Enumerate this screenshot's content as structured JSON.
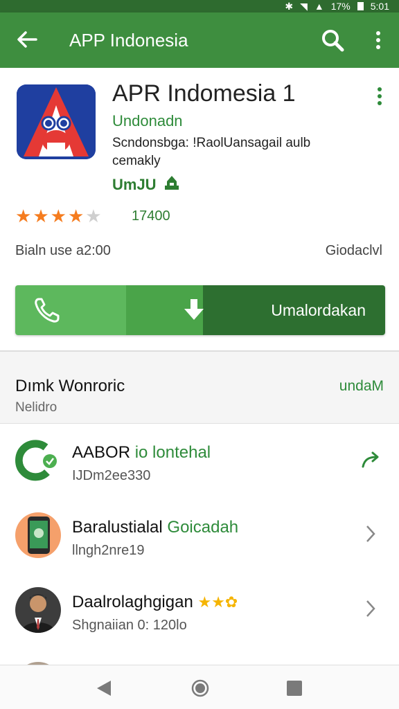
{
  "status_bar": {
    "battery": "17%",
    "time": "5:01",
    "icons": [
      "bluetooth-icon",
      "wifi-icon",
      "signal-icon"
    ]
  },
  "app_bar": {
    "title": "APP Indonesia",
    "icons": [
      "back-arrow-icon",
      "search-icon",
      "overflow-menu-icon"
    ]
  },
  "app": {
    "name": "APR Indomesia 1",
    "developer": "Undonadn",
    "description": "Scndonsbga: !RaolUansagail aulb cemakly",
    "badge_label": "UmJU",
    "rating_stars": 4,
    "rating_max": 5,
    "rating_count": "17400",
    "meta_left": "Bialn use a2:00",
    "meta_right": "Giodaclvl",
    "install_label": "Umalordakan"
  },
  "section": {
    "title": "Dımk Wonroric",
    "subtitle": "Nelidro",
    "link": "undaM"
  },
  "list": [
    {
      "title": "AABOR",
      "title_accent": "io lontehal",
      "subtitle": "IJDm2ee330",
      "trail_icon": "share-arrow-icon"
    },
    {
      "title": "Baralustialal",
      "title_accent": "Goicadah",
      "subtitle": "llngh2nre19",
      "trail_icon": "chevron-right-icon"
    },
    {
      "title": "Daalrolaghgigan",
      "title_accent": "",
      "subtitle": "Shgnaiian 0: 120lo",
      "trail_icon": "chevron-right-icon"
    }
  ],
  "colors": {
    "primary": "#3e8e3f",
    "status_bar": "#2e6b2f",
    "accent_green": "#2e8b3a",
    "star": "#f57c1f",
    "install_dark": "#2d6f30"
  }
}
